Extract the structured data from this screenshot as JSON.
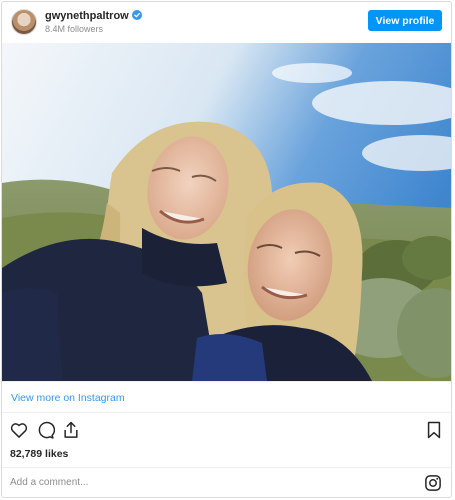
{
  "header": {
    "username": "gwynethpaltrow",
    "followers": "8.4M followers",
    "view_profile_label": "View profile"
  },
  "photo": {
    "icon": "selfie-photo",
    "sky_color": "#4a8fd4",
    "grass_color": "#7b8f4e"
  },
  "links": {
    "view_more_label": "View more on Instagram"
  },
  "actions": {
    "like_icon": "heart-icon",
    "comment_icon": "comment-icon",
    "share_icon": "share-icon",
    "save_icon": "bookmark-icon"
  },
  "stats": {
    "likes": "82,789 likes"
  },
  "comment": {
    "placeholder": "Add a comment..."
  },
  "colors": {
    "accent": "#0095f6",
    "link": "#3897f0",
    "verified": "#3897f0"
  }
}
